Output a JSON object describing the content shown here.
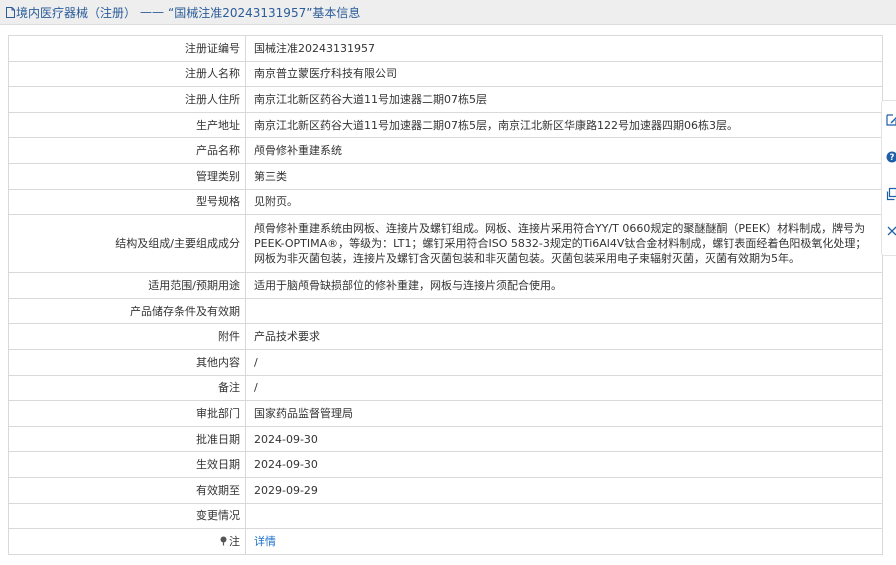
{
  "header": {
    "section": "境内医疗器械（注册）",
    "separator": "——",
    "record_title": "“国械注准20243131957”基本信息"
  },
  "rows": [
    {
      "label": "注册证编号",
      "value": "国械注准20243131957"
    },
    {
      "label": "注册人名称",
      "value": "南京普立蒙医疗科技有限公司"
    },
    {
      "label": "注册人住所",
      "value": "南京江北新区药谷大道11号加速器二期07栋5层"
    },
    {
      "label": "生产地址",
      "value": "南京江北新区药谷大道11号加速器二期07栋5层，南京江北新区华康路122号加速器四期06栋3层。"
    },
    {
      "label": "产品名称",
      "value": "颅骨修补重建系统"
    },
    {
      "label": "管理类别",
      "value": "第三类"
    },
    {
      "label": "型号规格",
      "value": "见附页。"
    },
    {
      "label": "结构及组成/主要组成成分",
      "value": "颅骨修补重建系统由网板、连接片及螺钉组成。网板、连接片采用符合YY/T 0660规定的聚醚醚酮（PEEK）材料制成，牌号为PEEK-OPTIMA®，等级为：LT1；螺钉采用符合ISO 5832-3规定的Ti6Al4V钛合金材料制成，螺钉表面经着色阳极氧化处理；网板为非灭菌包装，连接片及螺钉含灭菌包装和非灭菌包装。灭菌包装采用电子束辐射灭菌，灭菌有效期为5年。"
    },
    {
      "label": "适用范围/预期用途",
      "value": "适用于脑颅骨缺损部位的修补重建，网板与连接片须配合使用。"
    },
    {
      "label": "产品储存条件及有效期",
      "value": ""
    },
    {
      "label": "附件",
      "value": "产品技术要求"
    },
    {
      "label": "其他内容",
      "value": "/"
    },
    {
      "label": "备注",
      "value": "/"
    },
    {
      "label": "审批部门",
      "value": "国家药品监督管理局"
    },
    {
      "label": "批准日期",
      "value": "2024-09-30"
    },
    {
      "label": "生效日期",
      "value": "2024-09-30"
    },
    {
      "label": "有效期至",
      "value": "2029-09-29"
    },
    {
      "label": "变更情况",
      "value": ""
    }
  ],
  "note_row": {
    "label": "注",
    "link": "详情"
  },
  "colors": {
    "title_text": "#2a5c9a",
    "link": "#1a6fc9",
    "border": "#d9d9d9",
    "title_bg": "#eeeeee"
  },
  "side_toolbar": [
    "edit-icon",
    "help-icon",
    "copy-icon",
    "close-icon"
  ]
}
